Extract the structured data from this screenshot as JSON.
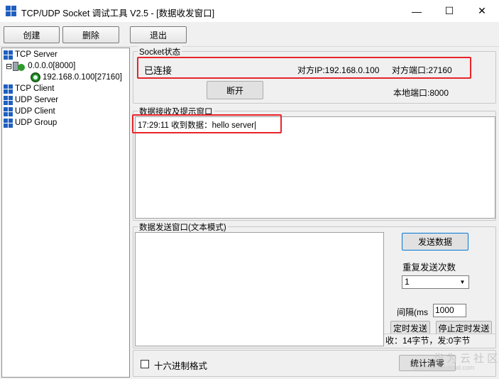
{
  "window": {
    "title": "TCP/UDP Socket 调试工具 V2.5 - [数据收发窗口]",
    "minimize_glyph": "—",
    "maximize_glyph": "☐",
    "close_glyph": "✕"
  },
  "toolbar": {
    "create_label": "创建",
    "delete_label": "删除",
    "exit_label": "退出"
  },
  "tree": {
    "items": [
      {
        "label": "TCP Server",
        "icon": "network-icon"
      },
      {
        "label": "0.0.0.0[8000]",
        "icon": "server-play-icon"
      },
      {
        "label": "192.168.0.100[27160]",
        "icon": "connection-icon"
      },
      {
        "label": "TCP Client",
        "icon": "network-icon"
      },
      {
        "label": "UDP Server",
        "icon": "network-icon"
      },
      {
        "label": "UDP Client",
        "icon": "network-icon"
      },
      {
        "label": "UDP Group",
        "icon": "network-icon"
      }
    ],
    "expander": "⊟"
  },
  "socket_status": {
    "group_title": "Socket状态",
    "state": "已连接",
    "peer_ip": "对方IP:192.168.0.100",
    "peer_port": "对方端口:27160",
    "disconnect_label": "断开",
    "local_port": "本地端口:8000"
  },
  "receive": {
    "group_title": "数据接收及提示窗口",
    "log": "17:29:11 收到数据：hello server|"
  },
  "send": {
    "group_title": "数据发送窗口(文本模式)",
    "send_label": "发送数据",
    "repeat_label": "重复发送次数",
    "repeat_value": "1",
    "interval_label": "间隔(ms",
    "interval_value": "1000",
    "timed_send_label": "定时发送",
    "stop_timed_send_label": "停止定时发送",
    "stats": "收：14字节，发:0字节"
  },
  "bottom": {
    "hex_format_label": "十六进制格式",
    "stats_clear_label": "统计清零"
  },
  "watermark": {
    "main": "华为云社区",
    "url": "bbs.huaweicloud.com"
  },
  "colors": {
    "highlight_border": "#e8242a",
    "accent": "#0078d7"
  }
}
